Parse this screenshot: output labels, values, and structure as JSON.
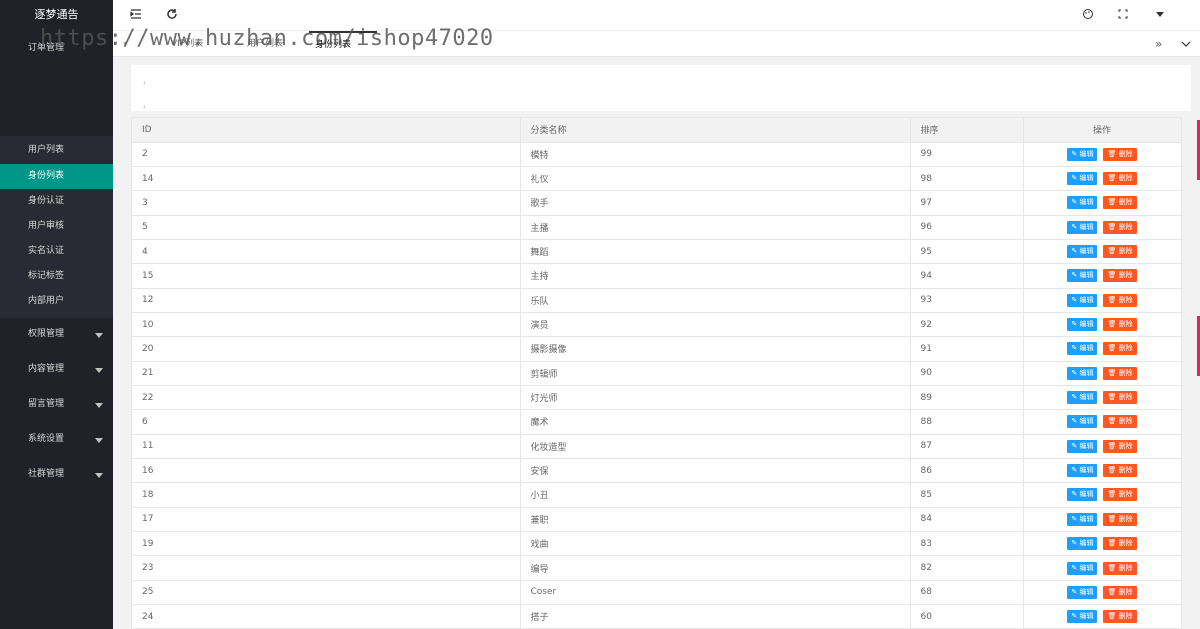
{
  "sidebar": {
    "title": "逐梦通告",
    "items": [
      {
        "label": "订单管理",
        "active": false,
        "expand": false
      },
      {
        "label": "用户列表",
        "active": false,
        "expand": false
      },
      {
        "label": "身份列表",
        "active": true,
        "expand": false
      },
      {
        "label": "身份认证",
        "active": false,
        "expand": false
      },
      {
        "label": "用户审核",
        "active": false,
        "expand": false
      },
      {
        "label": "实名认证",
        "active": false,
        "expand": false
      },
      {
        "label": "标记标签",
        "active": false,
        "expand": false
      },
      {
        "label": "内部用户",
        "active": false,
        "expand": false
      },
      {
        "label": "权限管理",
        "active": false,
        "expand": true
      },
      {
        "label": "内容管理",
        "active": false,
        "expand": true
      },
      {
        "label": "留言管理",
        "active": false,
        "expand": true
      },
      {
        "label": "系统设置",
        "active": false,
        "expand": true
      },
      {
        "label": "社群管理",
        "active": false,
        "expand": true
      }
    ]
  },
  "header": {
    "icons": [
      "menu-fold-icon",
      "refresh-icon",
      "theme-icon",
      "fullscreen-icon",
      "dropdown-icon"
    ]
  },
  "tabs": {
    "items": [
      "VIP列表",
      "用户列表",
      "身份列表"
    ],
    "active_index": 2
  },
  "watermark": "https://www.huzhan.com/ishop47020",
  "toolbox": {
    "lines": [
      "‹",
      "‹"
    ]
  },
  "table": {
    "headers": [
      "ID",
      "分类名称",
      "排序",
      "操作"
    ],
    "edit_label": "编辑",
    "delete_label": "删除",
    "rows": [
      {
        "id": "2",
        "name": "模特",
        "sort": "99"
      },
      {
        "id": "14",
        "name": "礼仪",
        "sort": "98"
      },
      {
        "id": "3",
        "name": "歌手",
        "sort": "97"
      },
      {
        "id": "5",
        "name": "主播",
        "sort": "96"
      },
      {
        "id": "4",
        "name": "舞蹈",
        "sort": "95"
      },
      {
        "id": "15",
        "name": "主持",
        "sort": "94"
      },
      {
        "id": "12",
        "name": "乐队",
        "sort": "93"
      },
      {
        "id": "10",
        "name": "演员",
        "sort": "92"
      },
      {
        "id": "20",
        "name": "摄影摄像",
        "sort": "91"
      },
      {
        "id": "21",
        "name": "剪辑师",
        "sort": "90"
      },
      {
        "id": "22",
        "name": "灯光师",
        "sort": "89"
      },
      {
        "id": "6",
        "name": "魔术",
        "sort": "88"
      },
      {
        "id": "11",
        "name": "化妆造型",
        "sort": "87"
      },
      {
        "id": "16",
        "name": "安保",
        "sort": "86"
      },
      {
        "id": "18",
        "name": "小丑",
        "sort": "85"
      },
      {
        "id": "17",
        "name": "兼职",
        "sort": "84"
      },
      {
        "id": "19",
        "name": "戏曲",
        "sort": "83"
      },
      {
        "id": "23",
        "name": "编导",
        "sort": "82"
      },
      {
        "id": "25",
        "name": "Coser",
        "sort": "68"
      },
      {
        "id": "24",
        "name": "搭子",
        "sort": "60"
      }
    ]
  },
  "colors": {
    "sidebar_bg": "#20222a",
    "active": "#009688",
    "edit": "#1e9fff",
    "delete": "#ff5722"
  }
}
